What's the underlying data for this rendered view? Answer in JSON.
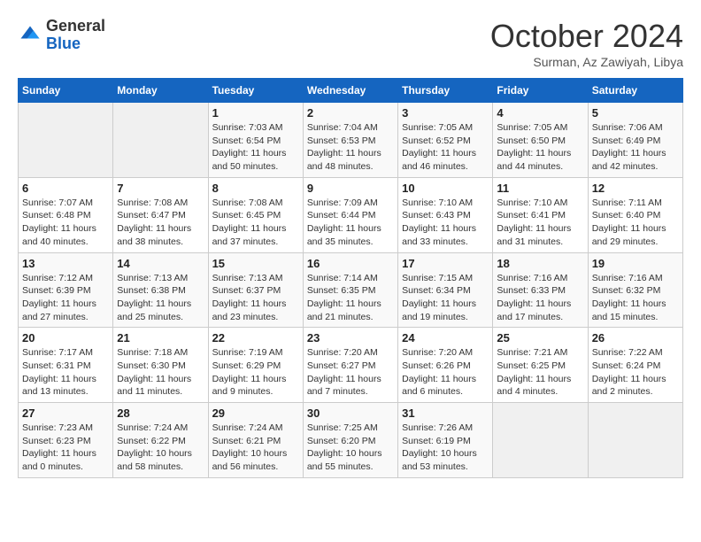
{
  "header": {
    "logo_general": "General",
    "logo_blue": "Blue",
    "month_title": "October 2024",
    "subtitle": "Surman, Az Zawiyah, Libya"
  },
  "weekdays": [
    "Sunday",
    "Monday",
    "Tuesday",
    "Wednesday",
    "Thursday",
    "Friday",
    "Saturday"
  ],
  "weeks": [
    [
      null,
      null,
      {
        "day": 1,
        "sunrise": "7:03 AM",
        "sunset": "6:54 PM",
        "daylight": "11 hours and 50 minutes."
      },
      {
        "day": 2,
        "sunrise": "7:04 AM",
        "sunset": "6:53 PM",
        "daylight": "11 hours and 48 minutes."
      },
      {
        "day": 3,
        "sunrise": "7:05 AM",
        "sunset": "6:52 PM",
        "daylight": "11 hours and 46 minutes."
      },
      {
        "day": 4,
        "sunrise": "7:05 AM",
        "sunset": "6:50 PM",
        "daylight": "11 hours and 44 minutes."
      },
      {
        "day": 5,
        "sunrise": "7:06 AM",
        "sunset": "6:49 PM",
        "daylight": "11 hours and 42 minutes."
      }
    ],
    [
      {
        "day": 6,
        "sunrise": "7:07 AM",
        "sunset": "6:48 PM",
        "daylight": "11 hours and 40 minutes."
      },
      {
        "day": 7,
        "sunrise": "7:08 AM",
        "sunset": "6:47 PM",
        "daylight": "11 hours and 38 minutes."
      },
      {
        "day": 8,
        "sunrise": "7:08 AM",
        "sunset": "6:45 PM",
        "daylight": "11 hours and 37 minutes."
      },
      {
        "day": 9,
        "sunrise": "7:09 AM",
        "sunset": "6:44 PM",
        "daylight": "11 hours and 35 minutes."
      },
      {
        "day": 10,
        "sunrise": "7:10 AM",
        "sunset": "6:43 PM",
        "daylight": "11 hours and 33 minutes."
      },
      {
        "day": 11,
        "sunrise": "7:10 AM",
        "sunset": "6:41 PM",
        "daylight": "11 hours and 31 minutes."
      },
      {
        "day": 12,
        "sunrise": "7:11 AM",
        "sunset": "6:40 PM",
        "daylight": "11 hours and 29 minutes."
      }
    ],
    [
      {
        "day": 13,
        "sunrise": "7:12 AM",
        "sunset": "6:39 PM",
        "daylight": "11 hours and 27 minutes."
      },
      {
        "day": 14,
        "sunrise": "7:13 AM",
        "sunset": "6:38 PM",
        "daylight": "11 hours and 25 minutes."
      },
      {
        "day": 15,
        "sunrise": "7:13 AM",
        "sunset": "6:37 PM",
        "daylight": "11 hours and 23 minutes."
      },
      {
        "day": 16,
        "sunrise": "7:14 AM",
        "sunset": "6:35 PM",
        "daylight": "11 hours and 21 minutes."
      },
      {
        "day": 17,
        "sunrise": "7:15 AM",
        "sunset": "6:34 PM",
        "daylight": "11 hours and 19 minutes."
      },
      {
        "day": 18,
        "sunrise": "7:16 AM",
        "sunset": "6:33 PM",
        "daylight": "11 hours and 17 minutes."
      },
      {
        "day": 19,
        "sunrise": "7:16 AM",
        "sunset": "6:32 PM",
        "daylight": "11 hours and 15 minutes."
      }
    ],
    [
      {
        "day": 20,
        "sunrise": "7:17 AM",
        "sunset": "6:31 PM",
        "daylight": "11 hours and 13 minutes."
      },
      {
        "day": 21,
        "sunrise": "7:18 AM",
        "sunset": "6:30 PM",
        "daylight": "11 hours and 11 minutes."
      },
      {
        "day": 22,
        "sunrise": "7:19 AM",
        "sunset": "6:29 PM",
        "daylight": "11 hours and 9 minutes."
      },
      {
        "day": 23,
        "sunrise": "7:20 AM",
        "sunset": "6:27 PM",
        "daylight": "11 hours and 7 minutes."
      },
      {
        "day": 24,
        "sunrise": "7:20 AM",
        "sunset": "6:26 PM",
        "daylight": "11 hours and 6 minutes."
      },
      {
        "day": 25,
        "sunrise": "7:21 AM",
        "sunset": "6:25 PM",
        "daylight": "11 hours and 4 minutes."
      },
      {
        "day": 26,
        "sunrise": "7:22 AM",
        "sunset": "6:24 PM",
        "daylight": "11 hours and 2 minutes."
      }
    ],
    [
      {
        "day": 27,
        "sunrise": "7:23 AM",
        "sunset": "6:23 PM",
        "daylight": "11 hours and 0 minutes."
      },
      {
        "day": 28,
        "sunrise": "7:24 AM",
        "sunset": "6:22 PM",
        "daylight": "10 hours and 58 minutes."
      },
      {
        "day": 29,
        "sunrise": "7:24 AM",
        "sunset": "6:21 PM",
        "daylight": "10 hours and 56 minutes."
      },
      {
        "day": 30,
        "sunrise": "7:25 AM",
        "sunset": "6:20 PM",
        "daylight": "10 hours and 55 minutes."
      },
      {
        "day": 31,
        "sunrise": "7:26 AM",
        "sunset": "6:19 PM",
        "daylight": "10 hours and 53 minutes."
      },
      null,
      null
    ]
  ],
  "labels": {
    "sunrise": "Sunrise:",
    "sunset": "Sunset:",
    "daylight": "Daylight:"
  }
}
